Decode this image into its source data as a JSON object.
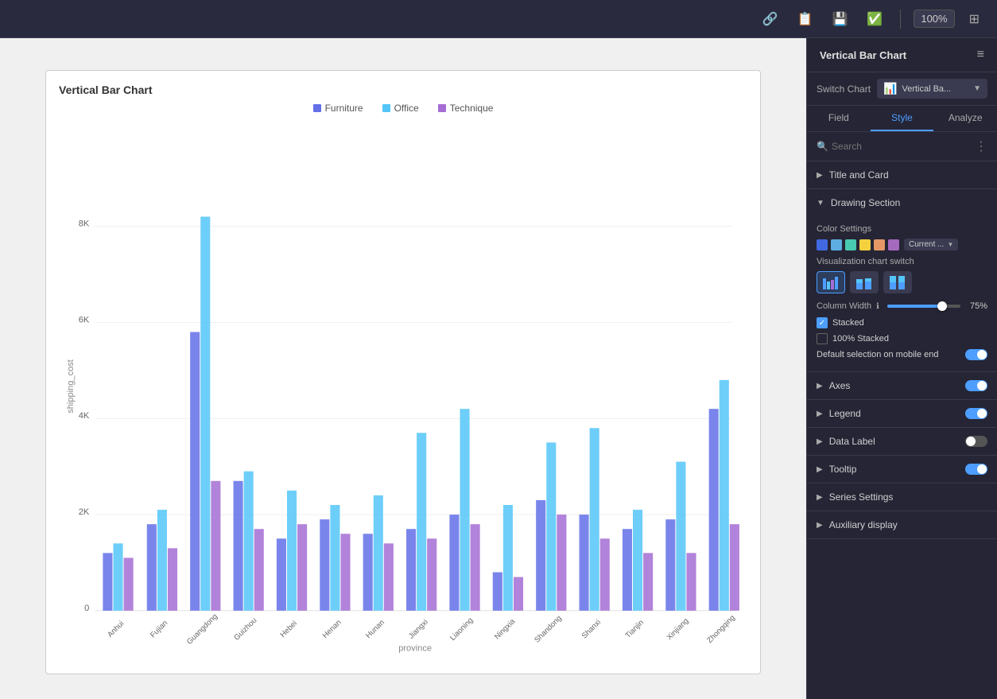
{
  "toolbar": {
    "zoom": "100%",
    "icons": [
      "link-icon",
      "copy-icon",
      "save-icon",
      "check-icon",
      "grid-icon"
    ]
  },
  "panel": {
    "title": "Vertical Bar Chart",
    "menu_icon": "≡",
    "switch_chart": {
      "label": "Switch Chart",
      "selected": "Vertical Ba...",
      "icon": "📊"
    },
    "tabs": [
      {
        "label": "Field",
        "active": false
      },
      {
        "label": "Style",
        "active": true
      },
      {
        "label": "Analyze",
        "active": false
      }
    ],
    "search": {
      "placeholder": "Search"
    },
    "sections": {
      "title_and_card": "Title and Card",
      "drawing_section": "Drawing Section",
      "color_settings_label": "Color Settings",
      "color_swatches": [
        "#4169E1",
        "#5DADE2",
        "#48C9B0",
        "#F4D03F",
        "#E59866",
        "#A569BD"
      ],
      "color_dropdown": "Current ...",
      "viz_switch_label": "Visualization chart switch",
      "column_width_label": "Column Width",
      "column_width_value": "75%",
      "stacked_label": "Stacked",
      "stacked_100_label": "100% Stacked",
      "mobile_label": "Default selection on mobile end",
      "axes_label": "Axes",
      "legend_label": "Legend",
      "data_label_label": "Data Label",
      "tooltip_label": "Tooltip",
      "series_settings_label": "Series Settings",
      "auxiliary_display_label": "Auxiliary display"
    }
  },
  "chart": {
    "title": "Vertical Bar Chart",
    "y_axis_label": "shipping_cost",
    "x_axis_label": "province",
    "y_ticks": [
      "0",
      "2K",
      "4K",
      "6K",
      "8K"
    ],
    "legend": [
      {
        "label": "Furniture",
        "color": "#6370e8"
      },
      {
        "label": "Office",
        "color": "#54c5f8"
      },
      {
        "label": "Technique",
        "color": "#a56dd4"
      }
    ],
    "provinces": [
      "Anhui",
      "Fujian",
      "Guangdong",
      "Guizhou",
      "Hebei",
      "Henan",
      "Hunan",
      "Jiangxi",
      "Liaoning",
      "Ningxia",
      "Shandong",
      "Shanxi",
      "Tianjin",
      "Xinjiang",
      "Zhongqing"
    ],
    "bars": {
      "Furniture": [
        1200,
        1800,
        5800,
        2700,
        1500,
        1900,
        1600,
        1700,
        2000,
        800,
        2300,
        2000,
        1700,
        1900,
        4200
      ],
      "Office": [
        1400,
        2100,
        8200,
        2900,
        2500,
        2200,
        2400,
        3700,
        4200,
        2200,
        3500,
        3800,
        2100,
        3100,
        4800
      ],
      "Technique": [
        1100,
        1300,
        2700,
        1700,
        1800,
        1600,
        1400,
        1500,
        1800,
        700,
        2000,
        1500,
        1200,
        1200,
        1800
      ]
    }
  }
}
